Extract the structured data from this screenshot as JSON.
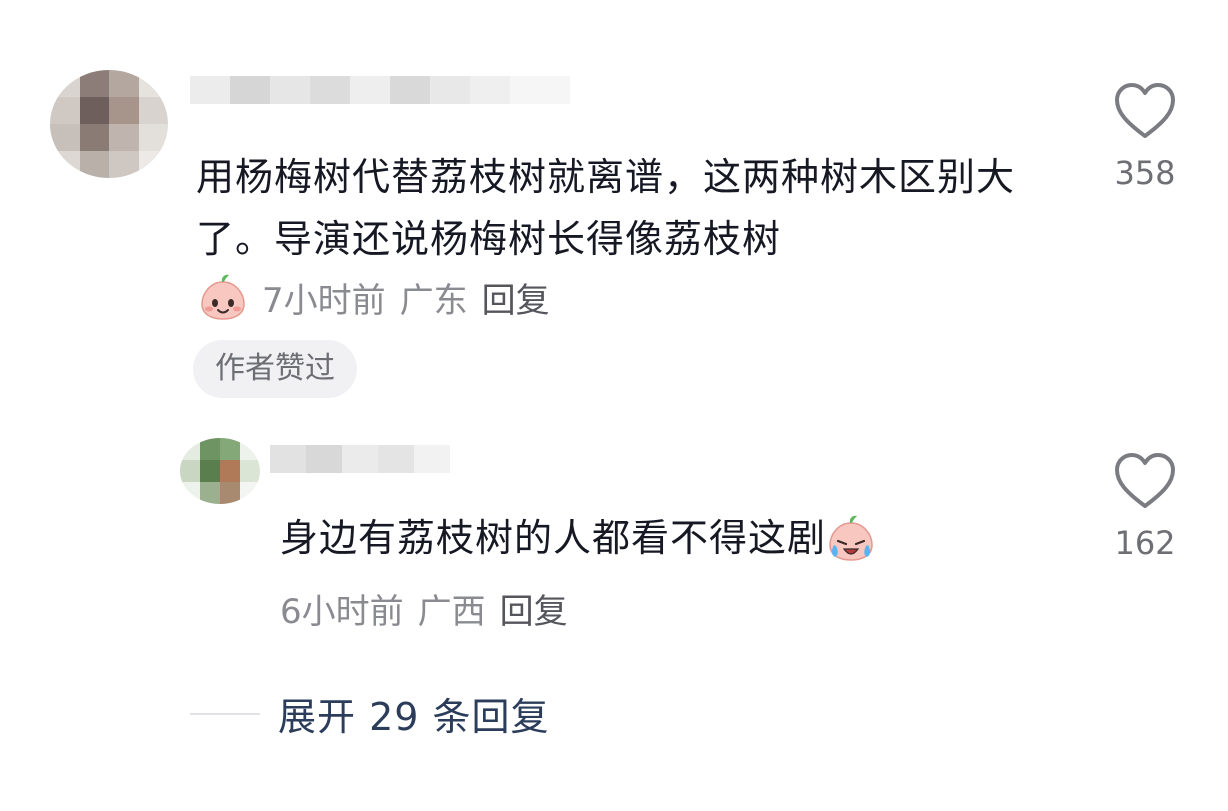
{
  "comment": {
    "text": "用杨梅树代替荔枝树就离谱，这两种树木区别大了。导演还说杨梅树长得像荔枝树",
    "time": "7小时前",
    "location": "广东",
    "reply_label": "回复",
    "author_liked_badge": "作者赞过",
    "like_count": "358",
    "emoji_icon": "smile-emoji-icon"
  },
  "reply": {
    "text": "身边有荔枝树的人都看不得这剧",
    "time": "6小时前",
    "location": "广西",
    "reply_label": "回复",
    "like_count": "162",
    "emoji_icon": "crying-emoji-icon"
  },
  "expand": {
    "label": "展开 29 条回复"
  },
  "colors": {
    "text": "#161823",
    "meta": "#8a8b91",
    "expand": "#2b3d5a",
    "badge_bg": "#f1f1f3"
  }
}
